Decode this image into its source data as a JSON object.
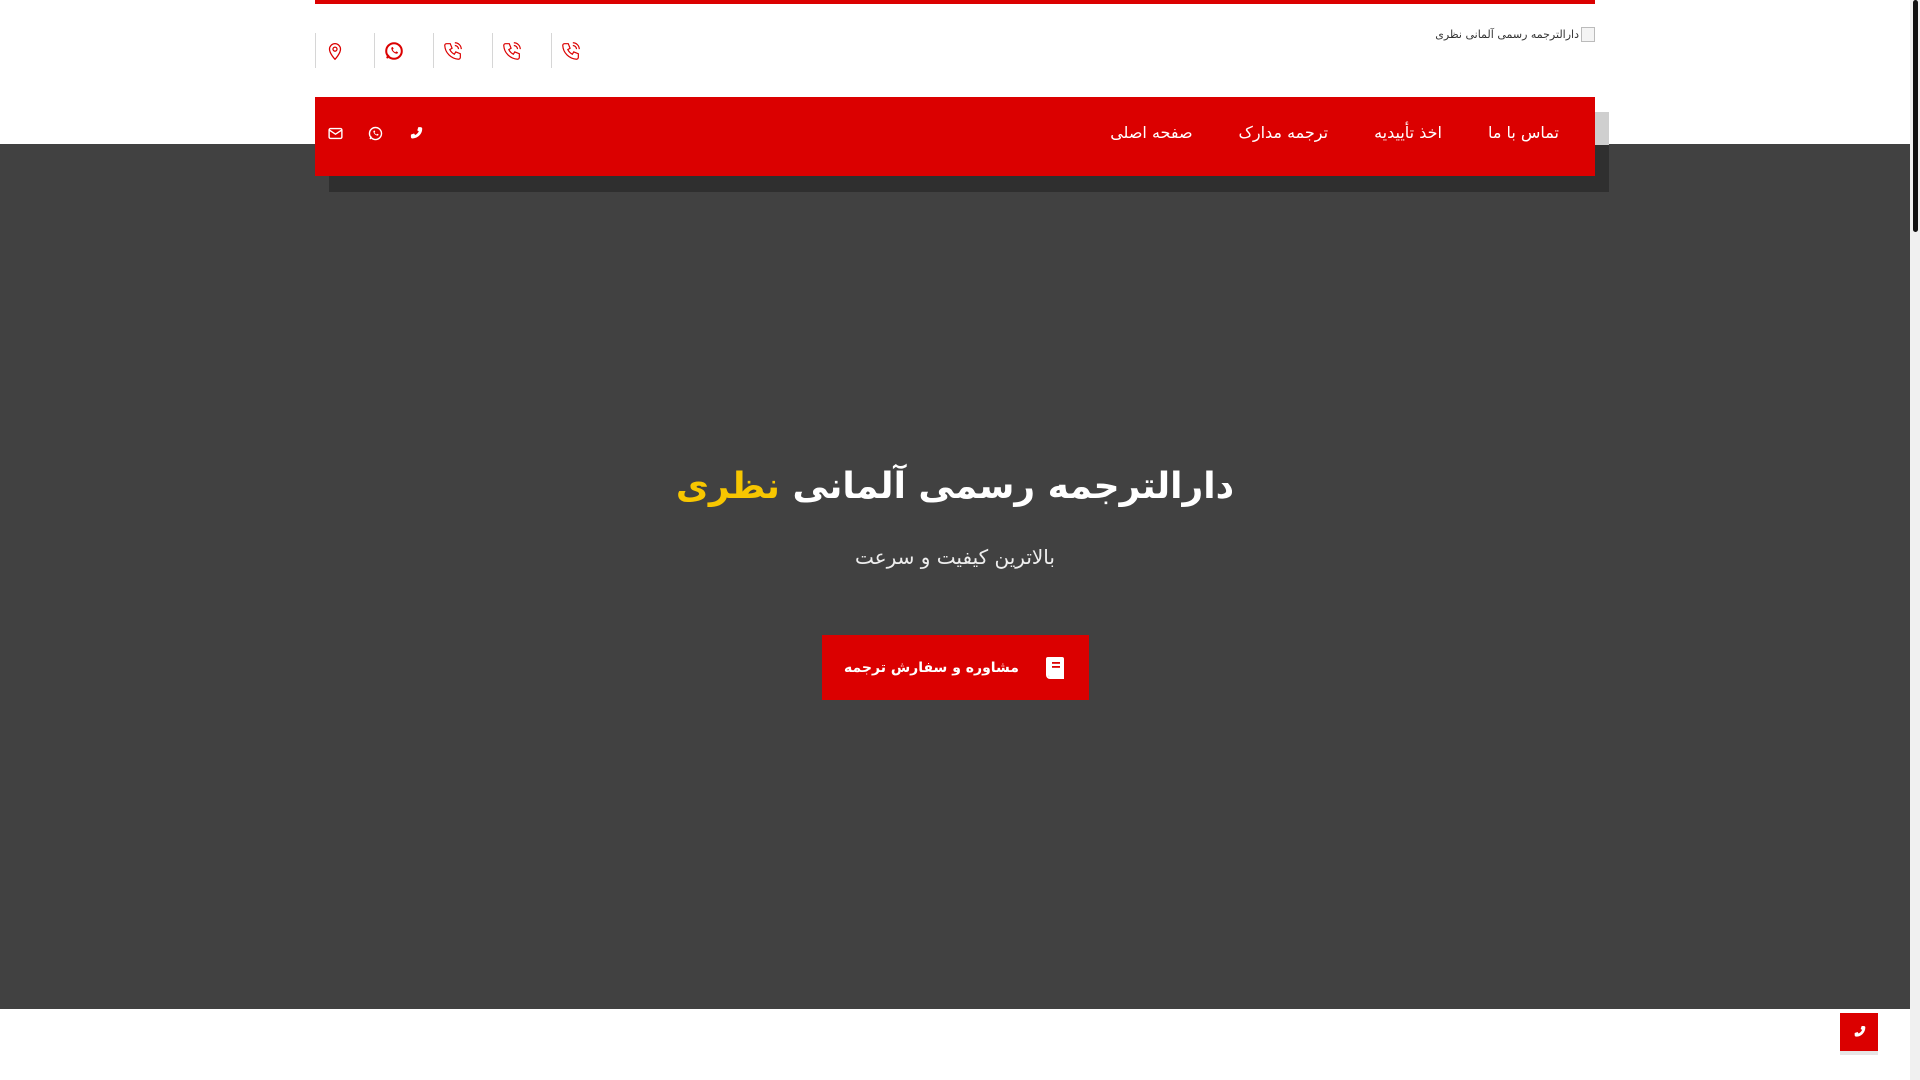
{
  "header": {
    "logo_alt": "دارالترجمه رسمی آلمانی نظری",
    "contact_icons": [
      "map-pin-icon",
      "whatsapp-icon",
      "phone-icon",
      "phone-icon",
      "phone-icon"
    ]
  },
  "nav": {
    "items": [
      {
        "label": "صفحه اصلی"
      },
      {
        "label": "ترجمه مدارک"
      },
      {
        "label": "اخذ تأییدیه"
      },
      {
        "label": "تماس با ما"
      }
    ],
    "social_icons": [
      "phone-icon",
      "whatsapp-icon",
      "mail-icon"
    ]
  },
  "hero": {
    "title_main": "دارالترجمه رسمی آلمانی",
    "title_accent": "نظری",
    "subtitle": "بالاترین کیفیت و سرعت",
    "cta_label": "مشاوره و سفارش ترجمه",
    "cta_icon": "book-icon"
  },
  "colors": {
    "brand_red": "#db0000",
    "accent_yellow": "#f7c600",
    "hero_bg": "#414141"
  },
  "floating": {
    "call_icon": "phone-icon"
  }
}
